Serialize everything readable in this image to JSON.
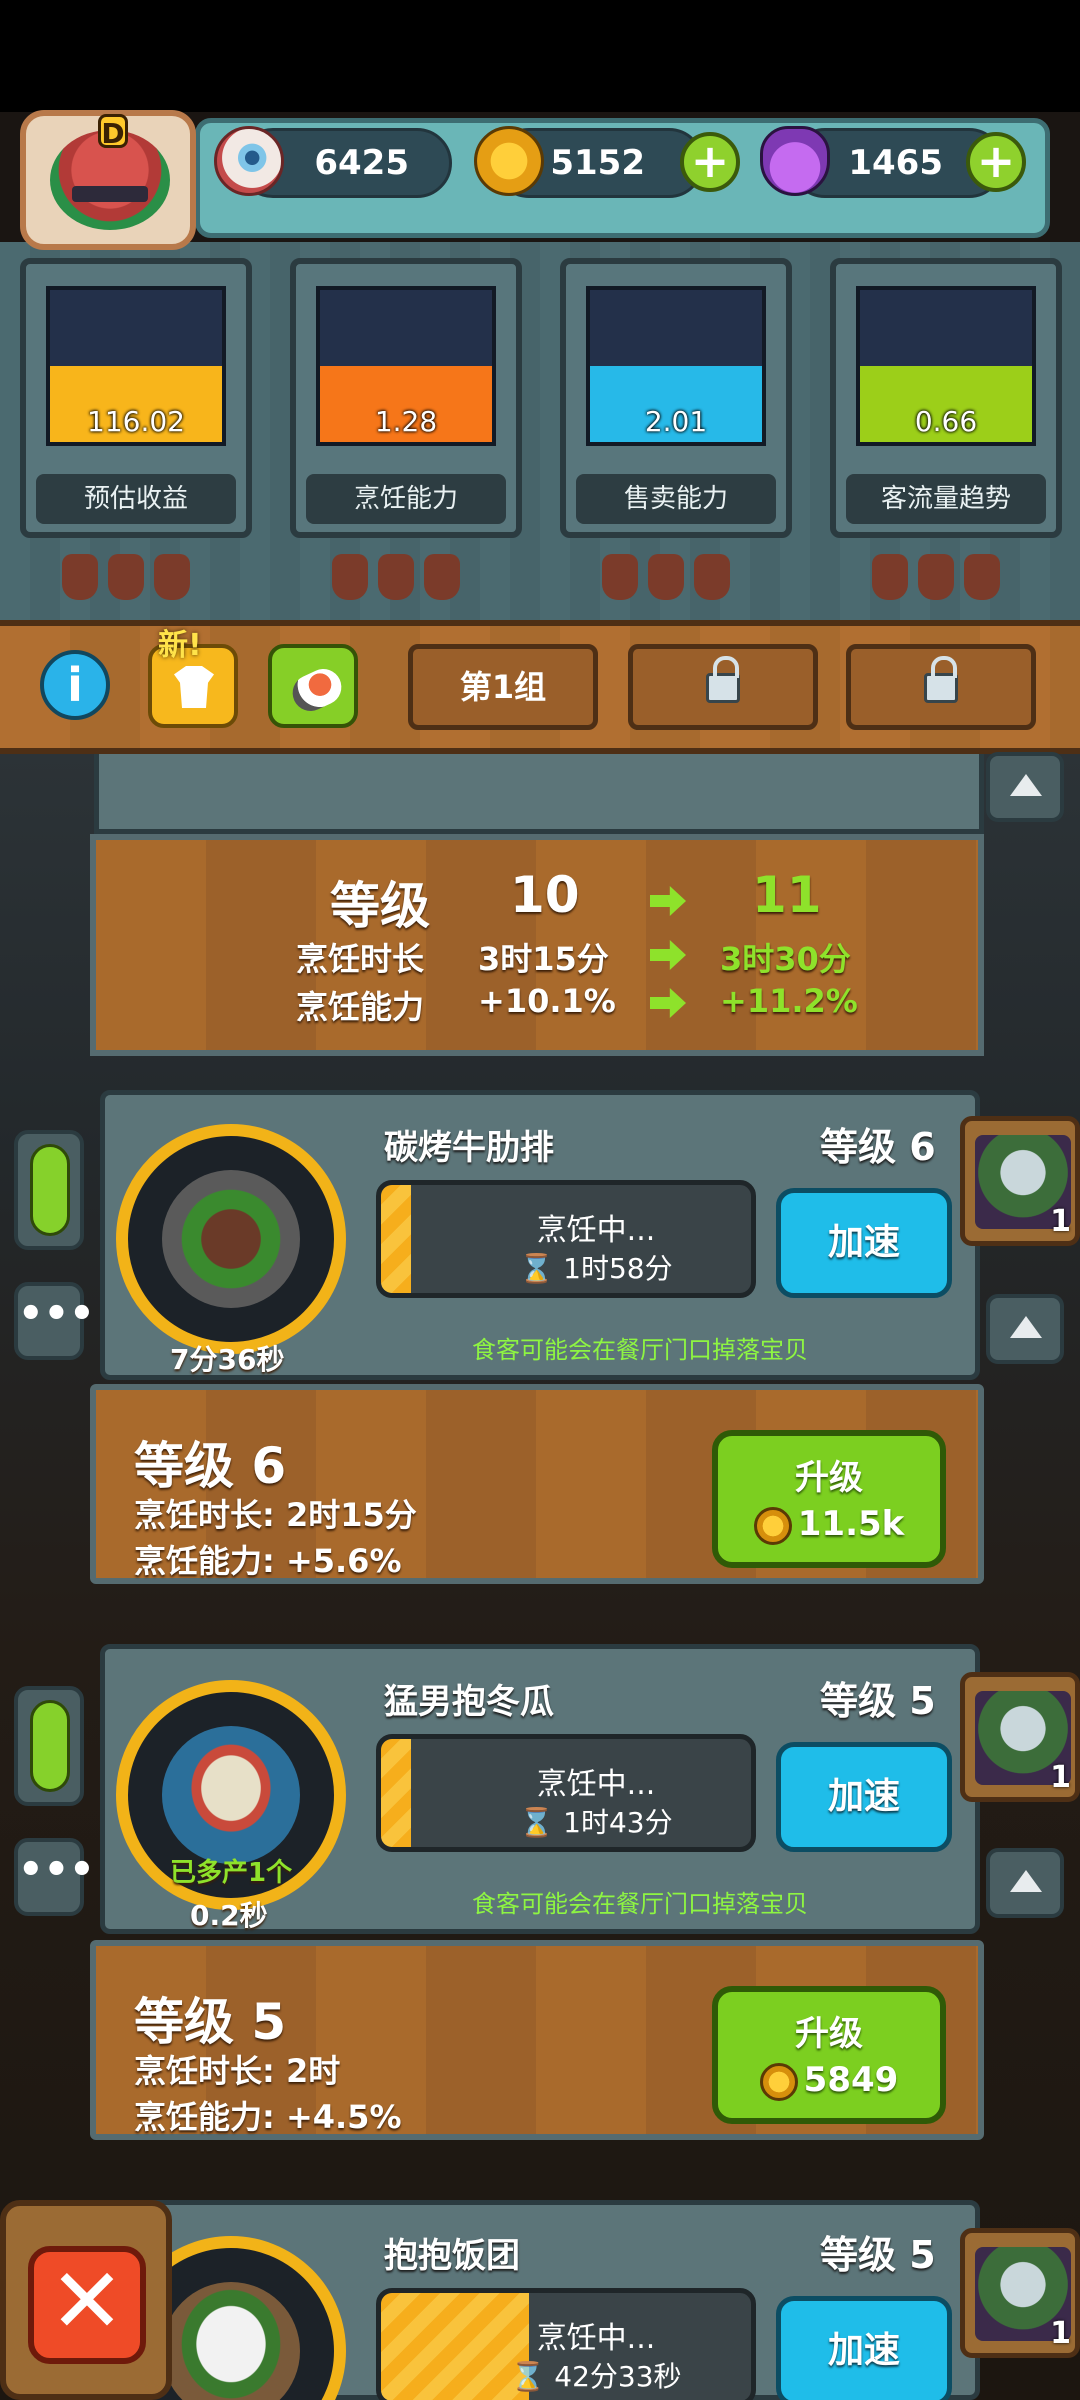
{
  "currencies": [
    {
      "icon": "eyeball-icon",
      "value": "6425"
    },
    {
      "icon": "coin-icon",
      "value": "5152"
    },
    {
      "icon": "potion-icon",
      "value": "1465"
    }
  ],
  "avatar": {
    "grade": "D"
  },
  "stats": [
    {
      "value": "116.02",
      "label": "预估收益",
      "color": "#f8b51b",
      "level": 0.5
    },
    {
      "value": "1.28",
      "label": "烹饪能力",
      "color": "#f67619",
      "level": 0.5
    },
    {
      "value": "2.01",
      "label": "售卖能力",
      "color": "#27b9e8",
      "level": 0.5
    },
    {
      "value": "0.66",
      "label": "客流量趋势",
      "color": "#9ccf19",
      "level": 0.5
    }
  ],
  "toolbar": {
    "new_tag": "新!",
    "group_tab": "第1组"
  },
  "summary": {
    "level_label": "等级",
    "level_from": "10",
    "level_to": "11",
    "time_label": "烹饪时长",
    "time_from": "3时15分",
    "time_to": "3时30分",
    "ability_label": "烹饪能力",
    "ability_from": "+10.1%",
    "ability_to": "+11.2%"
  },
  "recipes": [
    {
      "name": "碳烤牛肋排",
      "level": "等级 6",
      "ring_text": "7分36秒",
      "status": "烹饪中...",
      "remaining": "1时58分",
      "progress": 0.08,
      "speed_label": "加速",
      "drop_tip": "食客可能会在餐厅门口掉落宝贝",
      "chef_count": "1",
      "body_level": "等级 6",
      "body_time": "烹饪时长: 2时15分",
      "body_ability": "烹饪能力: +5.6%",
      "upgrade_label": "升级",
      "upgrade_price": "11.5k"
    },
    {
      "name": "猛男抱冬瓜",
      "level": "等级 5",
      "ring_extra": "已多产1个",
      "ring_text": "0.2秒",
      "status": "烹饪中...",
      "remaining": "1时43分",
      "progress": 0.08,
      "speed_label": "加速",
      "drop_tip": "食客可能会在餐厅门口掉落宝贝",
      "chef_count": "1",
      "body_level": "等级 5",
      "body_time": "烹饪时长: 2时",
      "body_ability": "烹饪能力: +4.5%",
      "upgrade_label": "升级",
      "upgrade_price": "5849"
    },
    {
      "name": "抱抱饭团",
      "level": "等级 5",
      "status": "烹饪中...",
      "remaining": "42分33秒",
      "progress": 0.4,
      "speed_label": "加速",
      "chef_count": "1"
    }
  ],
  "close_icon": "close-icon"
}
